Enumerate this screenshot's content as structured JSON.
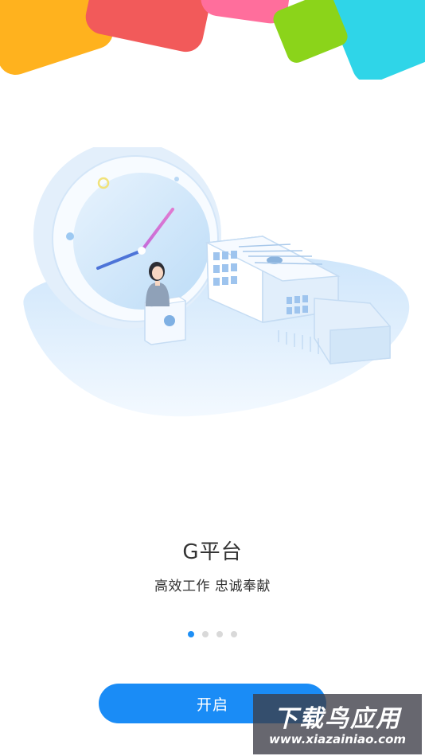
{
  "app": {
    "title": "G平台",
    "slogan": "高效工作 忠诚奉献"
  },
  "pager": {
    "count": 4,
    "active_index": 0
  },
  "actions": {
    "start_label": "开启"
  },
  "watermark": {
    "main": "下载鸟应用",
    "sub": "www.xiazainiao.com"
  },
  "colors": {
    "accent": "#1a8cf6",
    "dot_inactive": "#d9d9d9",
    "shape_orange": "#ffb21e",
    "shape_red": "#f25a5a",
    "shape_pink": "#ff6e9c",
    "shape_green": "#8bd41a",
    "shape_cyan": "#2fd5e8"
  }
}
